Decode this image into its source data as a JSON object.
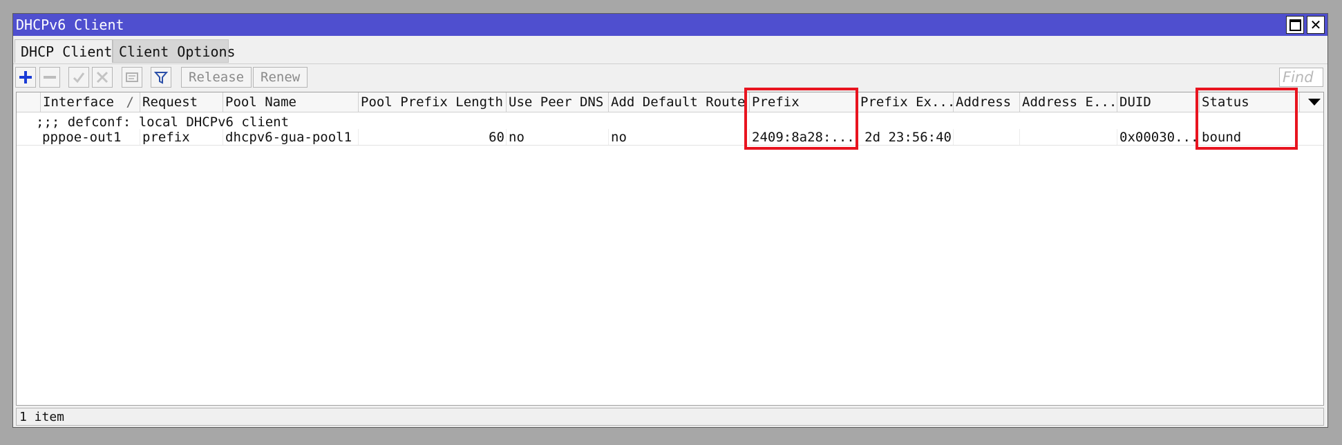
{
  "window": {
    "title": "DHCPv6 Client"
  },
  "tabs": [
    "DHCP Client",
    "Client Options"
  ],
  "toolbar": {
    "release_label": "Release",
    "renew_label": "Renew",
    "find_placeholder": "Find"
  },
  "columns": {
    "interface": "Interface",
    "sort_indicator": "/",
    "request": "Request",
    "pool_name": "Pool Name",
    "pool_prefix_length": "Pool Prefix Length",
    "use_peer_dns": "Use Peer DNS",
    "add_default_route": "Add Default Route",
    "prefix": "Prefix",
    "prefix_expires": "Prefix Ex...",
    "address": "Address",
    "address_expires": "Address E...",
    "duid": "DUID",
    "status": "Status"
  },
  "comment": ";;; defconf: local DHCPv6 client",
  "row": {
    "interface": "pppoe-out1",
    "request": "prefix",
    "pool_name": "dhcpv6-gua-pool1",
    "pool_prefix_length": "60",
    "use_peer_dns": "no",
    "add_default_route": "no",
    "prefix": "2409:8a28:...",
    "prefix_expires": "2d 23:56:40",
    "address": "",
    "address_expires": "",
    "duid": "0x00030...",
    "status": "bound"
  },
  "status_bar": {
    "count": "1 item"
  },
  "colors": {
    "titlebar": "#4f4fcf",
    "highlight": "#e8141f",
    "add_icon": "#1a3bd6"
  }
}
